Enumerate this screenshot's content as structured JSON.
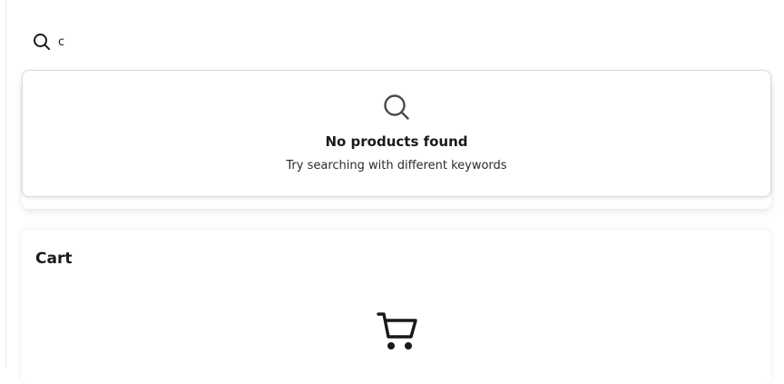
{
  "search": {
    "value": "c",
    "icon": "search-icon"
  },
  "results": {
    "empty_icon": "search-icon",
    "empty_title": "No products found",
    "empty_subtitle": "Try searching with different keywords"
  },
  "cart": {
    "title": "Cart",
    "empty_icon": "cart-icon"
  },
  "colors": {
    "text": "#1a1a1a",
    "icon": "#4a4a4a",
    "border": "#dcdcdc"
  }
}
